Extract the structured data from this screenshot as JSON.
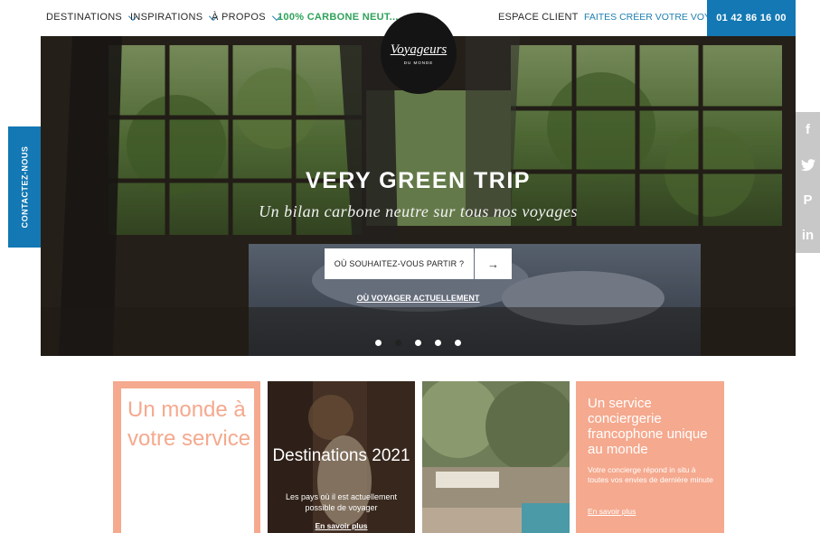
{
  "header": {
    "nav": [
      {
        "label": "DESTINATIONS",
        "chevron": true
      },
      {
        "label": "INSPIRATIONS",
        "chevron": true
      },
      {
        "label": "À PROPOS",
        "chevron": true
      },
      {
        "label": "100% CARBONE NEUT...",
        "chevron": false
      }
    ],
    "espace_client": "ESPACE CLIENT",
    "creer_voyage": "FAITES CRÉER VOTRE VOYAGE",
    "phone": "01 42 86 16 00"
  },
  "logo": {
    "name": "Voyageurs",
    "subtitle": "DU MONDE"
  },
  "contact_tab": "CONTACTEZ-NOUS",
  "hero": {
    "title": "VERY GREEN TRIP",
    "subtitle": "Un bilan carbone neutre sur tous nos voyages",
    "search_label": "OÙ SOUHAITEZ-VOUS PARTIR ?",
    "search_arrow": "→",
    "link": "OÙ VOYAGER ACTUELLEMENT",
    "slides_count": 5,
    "active_slide": 2
  },
  "social": [
    "facebook-icon",
    "twitter-icon",
    "pinterest-icon",
    "linkedin-icon"
  ],
  "social_glyphs": [
    "f",
    "🐦",
    "P",
    "in"
  ],
  "cards": {
    "card1": {
      "text": "Un monde à votre service"
    },
    "card2": {
      "title": "Destinations 2021",
      "desc": "Les pays où il est actuellement possible de voyager",
      "link": "En savoir plus"
    },
    "card4": {
      "title": "Un service conciergerie francophone unique au monde",
      "desc": "Votre concierge répond in situ à toutes vos envies de dernière minute",
      "link": "En savoir plus"
    }
  },
  "colors": {
    "accent_blue": "#1378b3",
    "green": "#2ea25a",
    "salmon": "#f5a98e"
  }
}
